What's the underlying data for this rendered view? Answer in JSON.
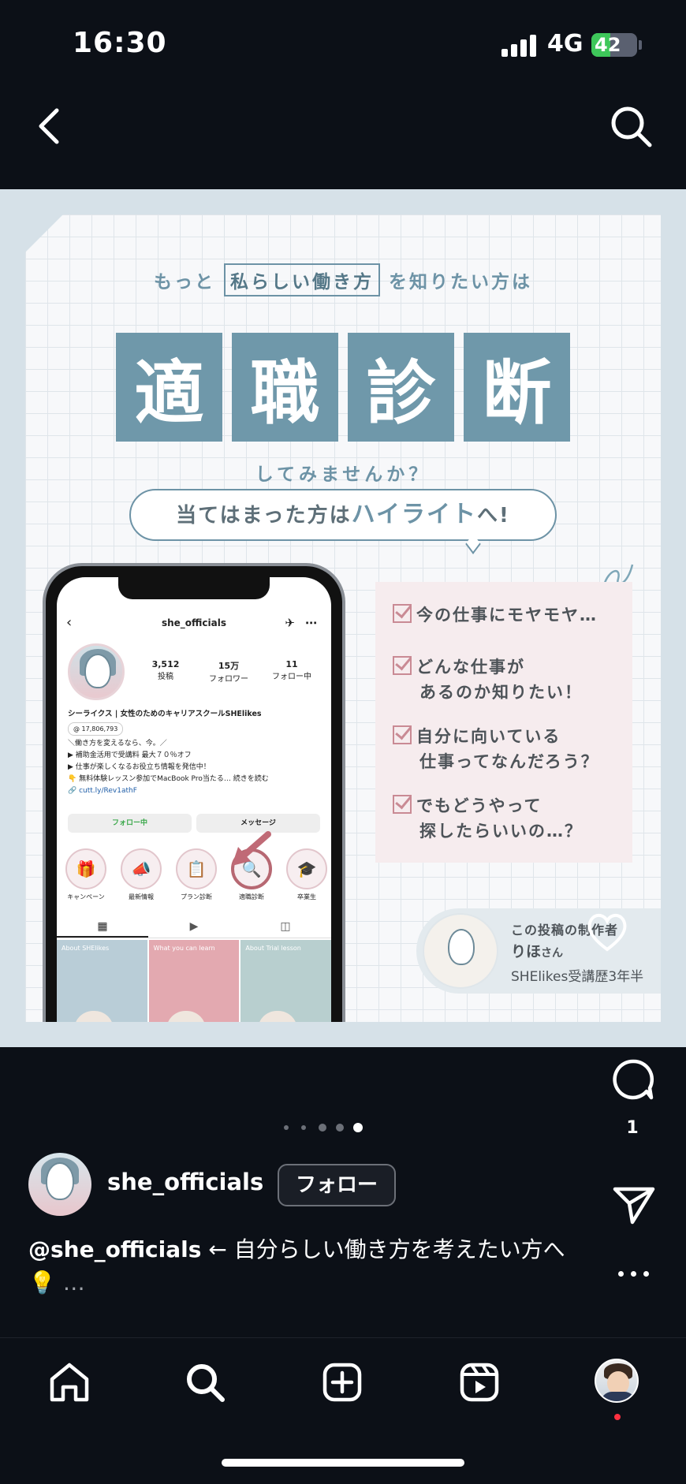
{
  "status_bar": {
    "time": "16:30",
    "network": "4G",
    "battery": "42",
    "battery_level": 0.42
  },
  "post": {
    "lead_pre": "もっと",
    "lead_boxed": "私らしい働き方",
    "lead_post": "を知りたい方は",
    "title_chars": [
      "適",
      "職",
      "診",
      "断"
    ],
    "subtitle": "してみませんか？",
    "bubble_pre": "当てはまった方は",
    "bubble_highlight": "ハイライト",
    "bubble_post": "へ!",
    "checklist": [
      {
        "line1": "今の仕事にモヤモヤ…",
        "line2": ""
      },
      {
        "line1": "どんな仕事が",
        "line2": "あるのか知りたい！"
      },
      {
        "line1": "自分に向いている",
        "line2": "仕事ってなんだろう？"
      },
      {
        "line1": "でもどうやって",
        "line2": "探したらいいの…？"
      }
    ],
    "maker_label": "この投稿の制作者",
    "maker_name": "りほ",
    "maker_suffix": "さん",
    "maker_role": "SHElikes受講歴3年半"
  },
  "phone_mock": {
    "username": "she_officials",
    "stats": [
      {
        "value": "3,512",
        "label": "投稿"
      },
      {
        "value": "15万",
        "label": "フォロワー"
      },
      {
        "value": "11",
        "label": "フォロー中"
      }
    ],
    "bio_name": "シーライクス | 女性のためのキャリアスクールSHElikes",
    "threads_count": "17,806,793",
    "bio_lines": [
      "＼働き方を変えるなら、今。／",
      "▶ 補助金活用で受講料 最大７０％オフ",
      "▶ 仕事が楽しくなるお役立ち情報を発信中！",
      "👇 無料体験レッスン参加でMacBook Pro当たる… 続きを読む"
    ],
    "link": "cutt.ly/Rev1athF",
    "follow_button": "フォロー中",
    "message_button": "メッセージ",
    "highlights": [
      "キャンペーン",
      "最新情報",
      "プラン診断",
      "適職診断",
      "卒業生"
    ],
    "grid_labels": [
      "About SHElikes",
      "What you can learn",
      "About Trial lesson"
    ]
  },
  "actions": {
    "comment_count": "1"
  },
  "carousel": {
    "total": 5,
    "active": 5
  },
  "author": {
    "name": "she_officials",
    "follow_label": "フォロー"
  },
  "caption": {
    "handle": "@she_officials",
    "text": " ← 自分らしい働き方を考えたい方へ💡",
    "more": " …"
  },
  "colors": {
    "accent": "#6f98aa",
    "pink": "#c98a94",
    "background": "#0c1017",
    "tab_notification": "#ff3040"
  }
}
